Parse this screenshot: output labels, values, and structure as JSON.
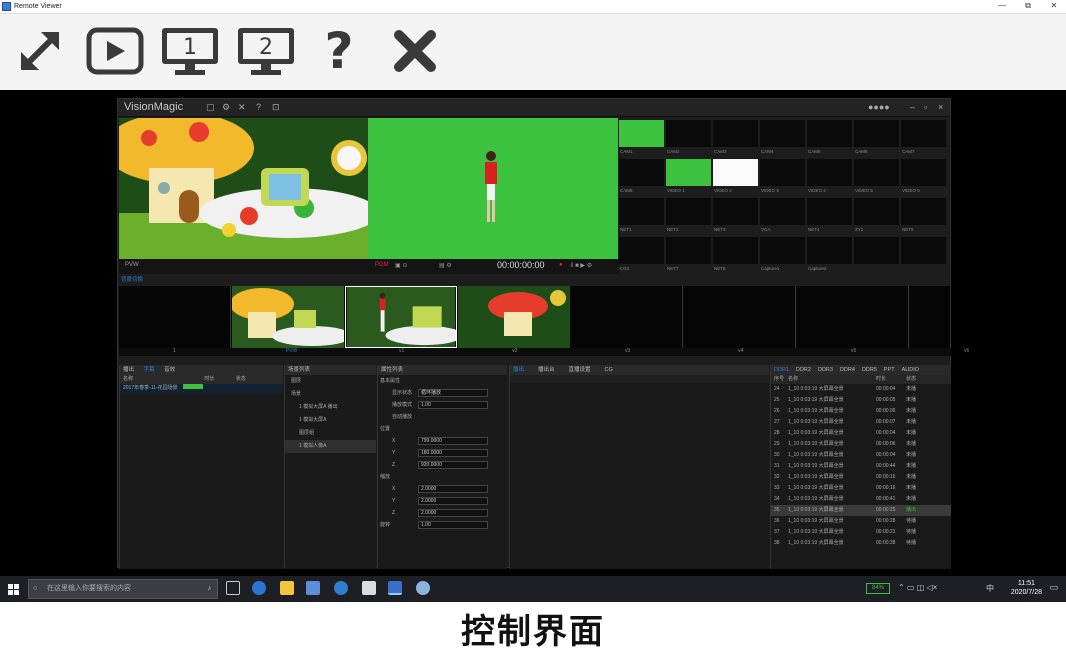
{
  "window": {
    "title": "Remote Viewer",
    "minimize": "—",
    "restore": "⧉",
    "close": "✕"
  },
  "toolbar": [
    {
      "icon": "fullscreen-arrows-icon"
    },
    {
      "icon": "play-icon"
    },
    {
      "icon": "monitor-1-icon",
      "label": "1"
    },
    {
      "icon": "monitor-2-icon",
      "label": "2"
    },
    {
      "icon": "help-icon",
      "label": "?"
    },
    {
      "icon": "close-x-icon"
    }
  ],
  "vm": {
    "app_name": "VisionMagic",
    "pvw_label": "PVW",
    "pgm_label": "PGM",
    "timecode": "00:00:00:00",
    "strip_label": "背景切换",
    "strip_labels": [
      "1",
      "PVW",
      "v1",
      "v2",
      "v3",
      "v4",
      "v5",
      "v6"
    ],
    "tiles": [
      "CAM1",
      "CAM2",
      "CAM3",
      "CAM4",
      "CAM5",
      "CAM6",
      "CAM7",
      "CAM8",
      "VIDEO 1",
      "VIDEO 2",
      "VIDEO 3",
      "VIDEO 4",
      "VIDEO 5",
      "VIDEO 6",
      "NET1",
      "NET2",
      "NET3",
      "VGA",
      "NET4",
      "ZY1",
      "NET5",
      "CG1",
      "NET7",
      "NET8",
      "Capture1",
      "Capture2",
      "",
      ""
    ],
    "tabs_left": [
      "播出",
      "字幕",
      "音效"
    ],
    "playlist_header": [
      "名称",
      "时长",
      "状态"
    ],
    "playlist_row": "2017年春季-11-花园场景",
    "tree_header": "场景列表",
    "tree": [
      "图层",
      "场景",
      "1 模拟大屏A 播出",
      "1 模拟大屏A",
      "图层组",
      "1 模拟人像A"
    ],
    "props_header": "属性列表",
    "props": [
      "基本属性",
      "显示状态",
      "播放模式",
      "自动播放",
      "位置",
      "X",
      "Y",
      "Z",
      "缩放",
      "X",
      "Y",
      "Z",
      "旋转"
    ],
    "prop_values": [
      "循环播放",
      "1.00",
      "799.0000",
      "180.0000",
      "920.0000",
      "2.0000",
      "2.0000",
      "2.0000",
      "1.00"
    ],
    "center_tabs": [
      "播出",
      "播出台",
      "直播设置",
      "CG"
    ],
    "right_tabs": [
      "DDR1",
      "DDR2",
      "DDR3",
      "DDR4",
      "DDR5",
      "PPT",
      "AUDIO"
    ],
    "right_header": [
      "序号",
      "名称",
      "时长",
      "状态"
    ],
    "right_rows": [
      {
        "n": "24",
        "name": "1_10 0:03:19 大屏幕全景",
        "dur": "00:00:04",
        "st": "未播"
      },
      {
        "n": "25",
        "name": "1_10 0:03:19 大屏幕全景",
        "dur": "00:00:05",
        "st": "未播"
      },
      {
        "n": "26",
        "name": "1_10 0:03:19 大屏幕全景",
        "dur": "00:00:06",
        "st": "未播"
      },
      {
        "n": "27",
        "name": "1_10 0:03:19 大屏幕全景",
        "dur": "00:00:07",
        "st": "未播"
      },
      {
        "n": "28",
        "name": "1_10 0:03:19 大屏幕全景",
        "dur": "00:00:04",
        "st": "未播"
      },
      {
        "n": "29",
        "name": "1_10 0:03:19 大屏幕全景",
        "dur": "00:00:06",
        "st": "未播"
      },
      {
        "n": "30",
        "name": "1_10 0:03:19 大屏幕全景",
        "dur": "00:00:04",
        "st": "未播"
      },
      {
        "n": "31",
        "name": "1_10 0:03:19 大屏幕全景",
        "dur": "00:00:44",
        "st": "未播"
      },
      {
        "n": "32",
        "name": "1_10 0:03:19 大屏幕全景",
        "dur": "00:00:16",
        "st": "未播"
      },
      {
        "n": "33",
        "name": "1_10 0:03:19 大屏幕全景",
        "dur": "00:00:16",
        "st": "未播"
      },
      {
        "n": "34",
        "name": "1_10 0:03:19 大屏幕全景",
        "dur": "00:00:41",
        "st": "未播"
      },
      {
        "n": "35",
        "name": "1_10 0:03:19 大屏幕全景",
        "dur": "00:00:25",
        "st": "播出"
      },
      {
        "n": "36",
        "name": "1_10 0:03:19 大屏幕全景",
        "dur": "00:00:28",
        "st": "待播"
      },
      {
        "n": "37",
        "name": "1_10 0:03:19 大屏幕全景",
        "dur": "00:00:21",
        "st": "待播"
      },
      {
        "n": "38",
        "name": "1_10 0:03:19 大屏幕全景",
        "dur": "00:00:38",
        "st": "待播"
      }
    ]
  },
  "taskbar": {
    "search_placeholder": "在这里输入你要搜索的内容",
    "battery": "84%",
    "ime": "中",
    "time": "11:51",
    "date": "2020/7/28"
  },
  "caption": "控制界面",
  "colors": {
    "accent": "#2f7fd1",
    "green_screen": "#3dc23f",
    "battery": "#3fbf3f"
  }
}
